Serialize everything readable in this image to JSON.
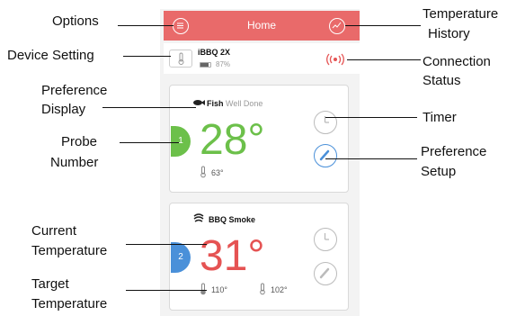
{
  "app": {
    "title": "Home",
    "colors": {
      "header": "#e96a6a",
      "green": "#6cc04a",
      "red": "#e55353",
      "blue": "#4a90d9"
    }
  },
  "device": {
    "name": "iBBQ 2X",
    "battery": "87%",
    "battery_level": 0.87
  },
  "probes": [
    {
      "number": "1",
      "food": "Fish",
      "doneness": "Well Done",
      "current_temp": "28°",
      "target_temp": "63°",
      "color": "#6cc04a"
    },
    {
      "number": "2",
      "food": "BBQ Smoke",
      "doneness": "",
      "current_temp": "31°",
      "target_low": "110°",
      "target_high": "102°",
      "color": "#4a90d9"
    }
  ],
  "annotations": {
    "options": "Options",
    "device_setting": "Device Setting",
    "preference_display": [
      "Preference",
      "Display"
    ],
    "probe_number": [
      "Probe",
      "Number"
    ],
    "current_temperature": [
      "Current",
      "Temperature"
    ],
    "target_temperature": [
      "Target",
      "Temperature"
    ],
    "temperature_history": [
      "Temperature",
      "History"
    ],
    "connection_status": [
      "Connection",
      "Status"
    ],
    "timer": "Timer",
    "preference_setup": [
      "Preference",
      "Setup"
    ]
  }
}
